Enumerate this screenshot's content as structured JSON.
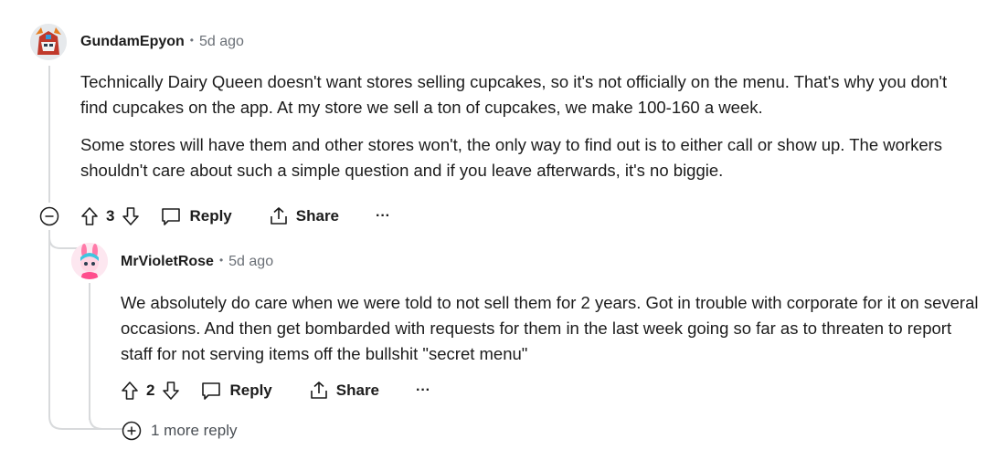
{
  "comments": [
    {
      "username": "GundamEpyon",
      "time": "5d ago",
      "paragraphs": [
        "Technically Dairy Queen doesn't want stores selling cupcakes, so it's not officially on the menu. That's why you don't find cupcakes on the app. At my store we sell a ton of cupcakes, we make 100-160 a week.",
        "Some stores will have them and other stores won't, the only way to find out is to either call or show up. The workers shouldn't care about such a simple question and if you leave afterwards, it's no biggie."
      ],
      "votes": "3",
      "reply_label": "Reply",
      "share_label": "Share",
      "more_label": "···"
    },
    {
      "username": "MrVioletRose",
      "time": "5d ago",
      "paragraphs": [
        "We absolutely do care when we were told to not sell them for 2 years. Got in trouble with corporate for it on several occasions. And then get bombarded with requests for them in the last week going so far as to threaten to report staff for not serving items off the bullshit \"secret menu\""
      ],
      "votes": "2",
      "reply_label": "Reply",
      "share_label": "Share",
      "more_label": "···"
    }
  ],
  "more_replies_label": "1 more reply",
  "colors": {
    "text": "#1c1c1c",
    "meta": "#6b7077",
    "thread_line": "#d8dadc"
  }
}
